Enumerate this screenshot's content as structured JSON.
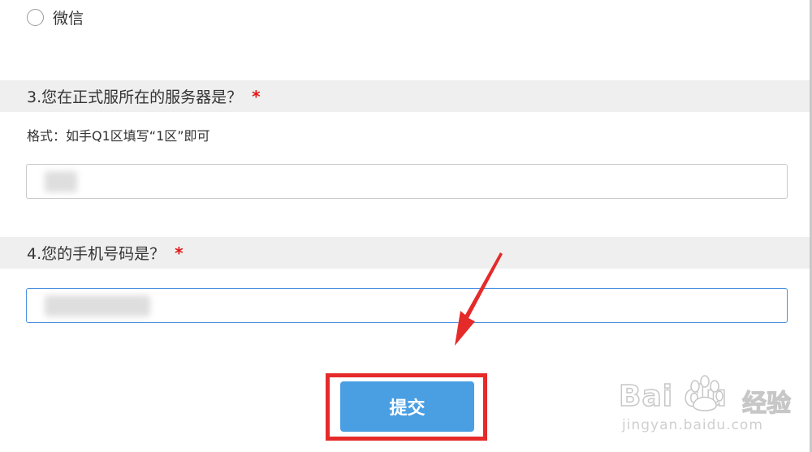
{
  "option_wechat": {
    "label": "微信"
  },
  "question3": {
    "title": "3.您在正式服所在的服务器是？",
    "required_mark": "*",
    "hint": "格式：如手Q1区填写“1区”即可",
    "value": ""
  },
  "question4": {
    "title": "4.您的手机号码是？",
    "required_mark": "*",
    "value": ""
  },
  "submit": {
    "label": "提交"
  },
  "watermark": {
    "brand": "Bai  du",
    "product": "经验",
    "url": "jingyan.baidu.com"
  },
  "colors": {
    "required": "#e01515",
    "submit_bg": "#4a9fe3",
    "focus_border": "#4a90e2",
    "highlight_box": "#e52a2a",
    "arrow": "#e52a2a",
    "question_bar": "#efefef"
  }
}
